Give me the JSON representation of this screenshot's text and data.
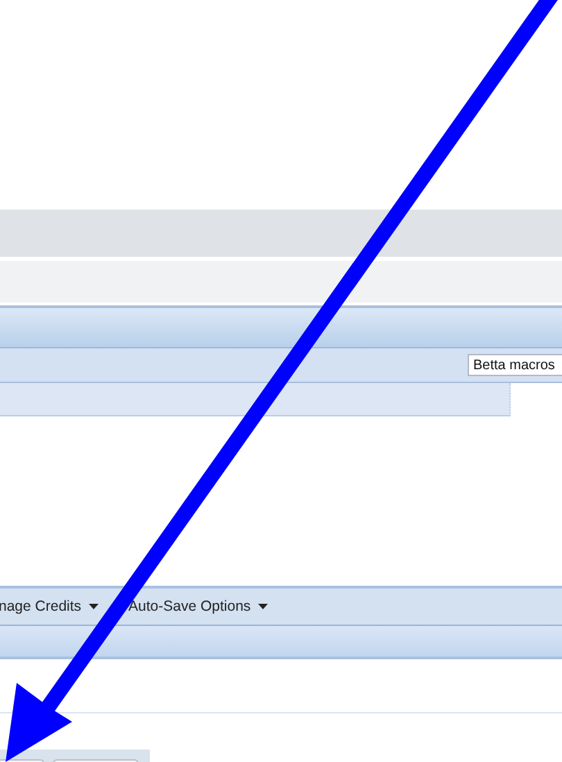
{
  "macro_field": {
    "value": "Betta macros"
  },
  "toolbar": {
    "menus": [
      {
        "label": "nage Credits"
      },
      {
        "label": "Auto-Save Options"
      }
    ]
  },
  "annotation": {
    "kind": "arrow"
  }
}
